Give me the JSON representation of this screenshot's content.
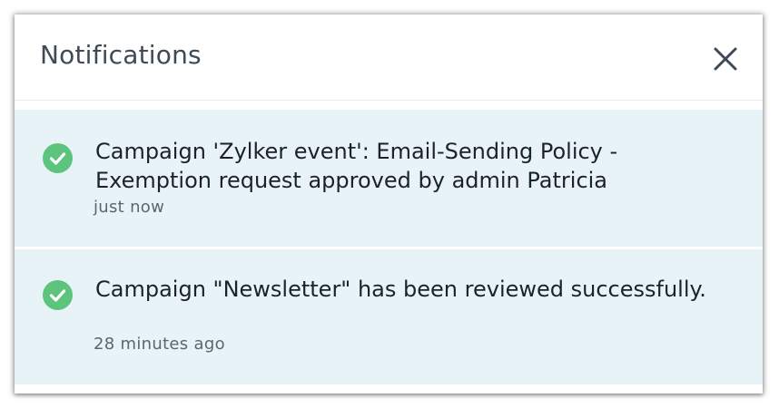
{
  "header": {
    "title": "Notifications",
    "close_icon": "close-icon"
  },
  "notifications": [
    {
      "message": "Campaign 'Zylker event': Email-Sending Policy - Exemption request approved by admin Patricia",
      "time": "just now",
      "status_icon": "check-circle-icon",
      "status_color": "#5cc47c"
    },
    {
      "message": "Campaign \"Newsletter\" has been reviewed successfully.",
      "time": "28 minutes ago",
      "status_icon": "check-circle-icon",
      "status_color": "#5cc47c"
    }
  ],
  "colors": {
    "item_background": "#e8f3f8",
    "title_text": "#3e4a57",
    "message_text": "#1d2228",
    "time_text": "#5b6570"
  }
}
